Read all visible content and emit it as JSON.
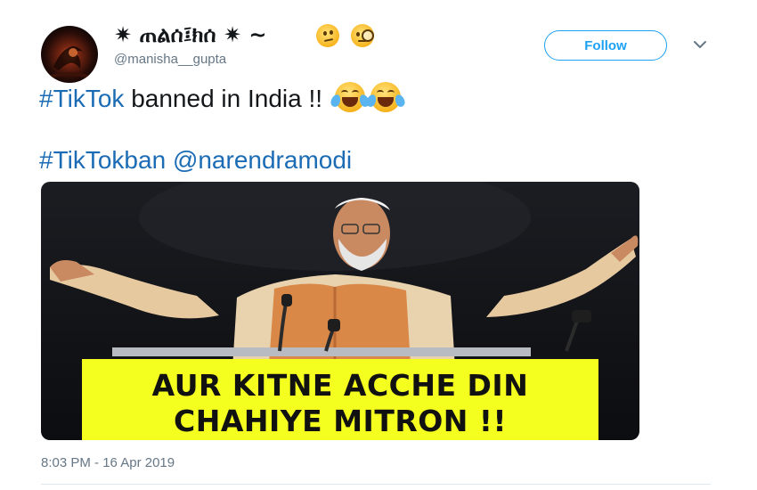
{
  "tweet": {
    "display_name": "✷ ጠልሰ፤ክሰ ✷ ~",
    "handle": "@manisha__gupta",
    "follow_label": "Follow",
    "line1": {
      "hashtag": "#TikTok",
      "text": " banned in India !!"
    },
    "line2": {
      "hashtag": "#TikTokban",
      "mention": "@narendramodi"
    },
    "timestamp": "8:03 PM - 16 Apr 2019"
  },
  "media": {
    "caption_line1": "AUR KITNE ACCHE DIN",
    "caption_line2": "CHAHIYE MITRON !!",
    "caption_bg": "#f4ff1f"
  },
  "colors": {
    "link": "#1b6cb5",
    "follow_accent": "#1da1f2",
    "meta_text": "#657786"
  },
  "icons": {
    "name_emojis": [
      "thinking-face-icon",
      "face-with-monocle-icon"
    ],
    "line1_emojis": [
      "tears-of-joy-icon",
      "tears-of-joy-icon"
    ],
    "menu": "chevron-down-icon"
  }
}
